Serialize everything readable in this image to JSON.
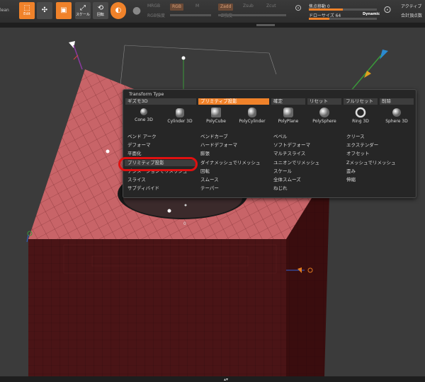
{
  "toolbar": {
    "left_cut": "lean",
    "btn_edit": "Edit",
    "btn_scale": "スケール",
    "btn_rotate": "回転",
    "rgb": "RGB",
    "m": "M",
    "mrgb": "MRGB",
    "rgb_strength": "RGB強度",
    "zadd": "Zadd",
    "zsub": "Zsub",
    "zcut": "Zcut",
    "z_strength": "Z強度",
    "focal_shift": "焦点移動 0",
    "draw_size": "ドローサイズ 64",
    "dynamic": "Dynamic",
    "active_points": "アクティブ",
    "total_points": "合計頂点数"
  },
  "popup": {
    "title": "Transform Type",
    "gizmo": "ギズモ3D",
    "primitive_projection": "プリミティブ投影",
    "confirm": "確定",
    "reset": "リセット",
    "full_reset": "フルリセット",
    "delete": "削除",
    "primitives": [
      "Cone 3D",
      "Cylinder 3D",
      "PolyCube",
      "PolyCylinder",
      "PolyPlane",
      "PolySphere",
      "Ring 3D",
      "Sphere 3D"
    ],
    "rows": [
      [
        "ベンド アーク",
        "ベンドカーブ",
        "ベベル",
        "クリース"
      ],
      [
        "デフォーマ",
        "ハードデフォーマ",
        "ソフトデフォーマ",
        "エクステンダー"
      ],
      [
        "平面化",
        "膨張",
        "マルチスライス",
        "オフセット"
      ],
      [
        "プリミティブ投影",
        "ダイナメッシュでリメッシュ",
        "ユニオンでリメッシュ",
        "Zメッシュでリメッシュ"
      ],
      [
        "デシメーションでリメッシュ",
        "回転",
        "スケール",
        "歪み"
      ],
      [
        "スライス",
        "スムース",
        "全体スムーズ",
        "伸縮"
      ],
      [
        "サブディバイド",
        "テーパー",
        "ねじれ",
        ""
      ]
    ]
  },
  "viewport": {
    "gizmo_value": "0"
  },
  "colors": {
    "accent": "#f0822a",
    "mesh_top": "#c86468",
    "mesh_side": "#4a1416",
    "highlight": "#e01010"
  }
}
